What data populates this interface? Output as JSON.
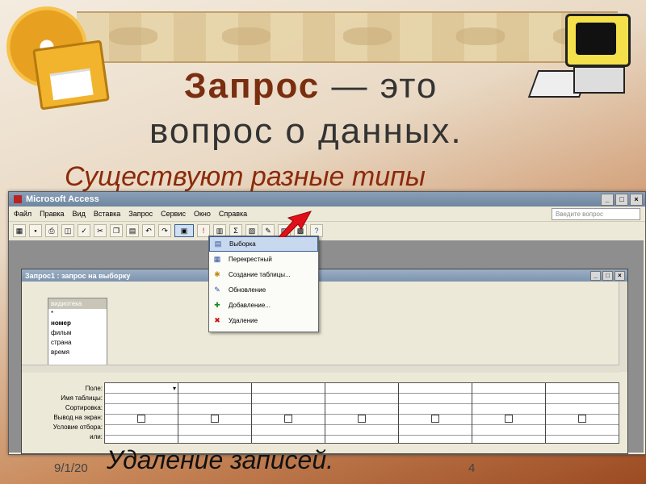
{
  "slide": {
    "title_bold": "Запрос",
    "title_rest": " — это",
    "title_line2": "вопрос о данных.",
    "subtitle": "Существуют разные типы",
    "bottom_text": "Удаление записей.",
    "date": "9/1/20",
    "page": "4"
  },
  "access": {
    "title": "Microsoft Access",
    "menu": [
      "Файл",
      "Правка",
      "Вид",
      "Вставка",
      "Запрос",
      "Сервис",
      "Окно",
      "Справка"
    ],
    "help_placeholder": "Введите вопрос",
    "query_window_title": "Запрос1 : запрос на выборку",
    "table": {
      "name": "видиотека",
      "fields": [
        "*",
        "номер",
        "фильм",
        "страна",
        "время"
      ]
    },
    "grid_labels": [
      "Поле:",
      "Имя таблицы:",
      "Сортировка:",
      "Вывод на экран:",
      "Условие отбора:",
      "или:"
    ],
    "dropdown_items": [
      {
        "label": "Выборка",
        "icon": "select-query-icon",
        "selected": true
      },
      {
        "label": "Перекрестный",
        "icon": "crosstab-query-icon",
        "selected": false
      },
      {
        "label": "Создание таблицы...",
        "icon": "make-table-query-icon",
        "selected": false
      },
      {
        "label": "Обновление",
        "icon": "update-query-icon",
        "selected": false
      },
      {
        "label": "Добавление...",
        "icon": "append-query-icon",
        "selected": false
      },
      {
        "label": "Удаление",
        "icon": "delete-query-icon",
        "selected": false
      }
    ]
  },
  "colors": {
    "title_bold": "#7a2e10",
    "subtitle": "#8b2a0a",
    "arrow": "#e0101a"
  }
}
